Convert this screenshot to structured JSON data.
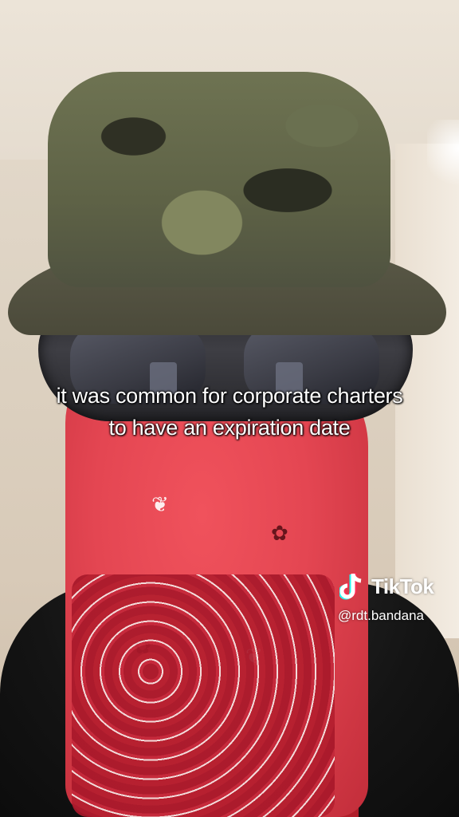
{
  "caption": {
    "line1": "it was common for corporate charters",
    "line2": "to have an expiration date"
  },
  "watermark": {
    "brand": "TikTok",
    "handle": "@rdt.bandana",
    "icon": "tiktok-logo-icon"
  },
  "colors": {
    "bandana": "#e44652",
    "camo": "#5e6246",
    "caption_text": "#ffffff"
  }
}
